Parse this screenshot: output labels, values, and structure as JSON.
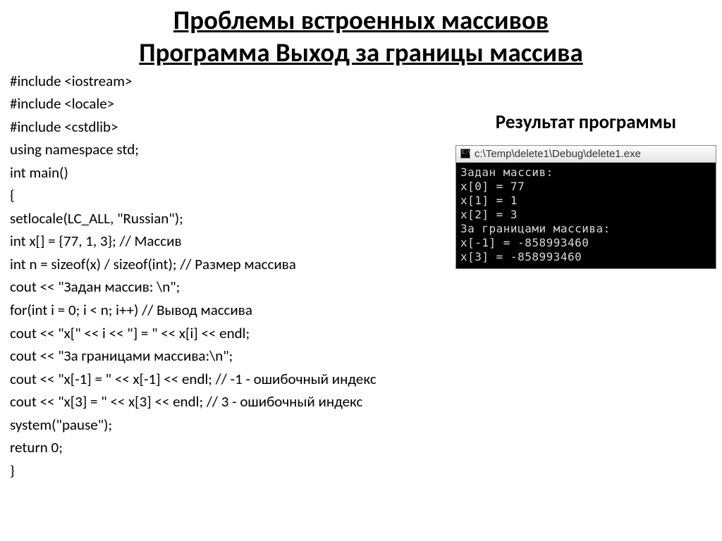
{
  "title_line1": "Проблемы встроенных массивов",
  "title_line2": "Программа  Выход за границы массива",
  "code_lines": [
    "#include <iostream>",
    "#include <locale>",
    "#include <cstdlib>",
    "using namespace std;",
    "int main()",
    "{",
    "setlocale(LC_ALL, \"Russian\");",
    "int x[] = {77, 1, 3}; // Массив",
    "int n = sizeof(x) / sizeof(int); // Размер массива",
    "cout << \"Задан массив: \\n\";",
    "for(int i = 0; i < n; i++) // Вывод массива",
    "cout << \"x[\" << i << \"] = \" << x[i] << endl;",
    "cout << \"За границами массива:\\n\";",
    "cout << \"x[-1] = \" << x[-1] << endl; // -1 - ошибочный индекс",
    "cout << \"x[3] = \" << x[3] << endl; // 3 - ошибочный индекс",
    "system(\"pause\");",
    "return 0;",
    "}"
  ],
  "result_heading": "Результат программы",
  "console": {
    "title": "c:\\Temp\\delete1\\Debug\\delete1.exe",
    "lines": [
      "Задан массив:",
      "x[0] = 77",
      "x[1] = 1",
      "x[2] = 3",
      "За границами массива:",
      "x[-1] = -858993460",
      "x[3] = -858993460"
    ]
  }
}
